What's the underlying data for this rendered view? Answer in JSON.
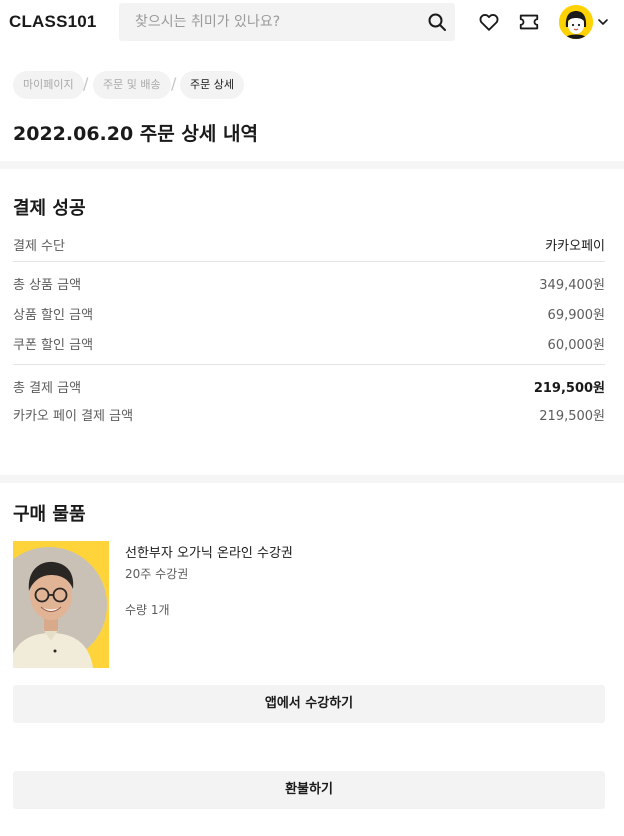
{
  "header": {
    "logo": "CLASS101",
    "search_placeholder": "찾으시는 취미가 있나요?",
    "icons": {
      "search": "search-icon",
      "wishlist": "heart-icon",
      "ticket": "ticket-icon",
      "avatar": "avatar",
      "menu": "chevron-down-icon"
    },
    "accent_color": "#ffd200"
  },
  "breadcrumb": {
    "items": [
      {
        "label": "마이페이지",
        "active": false
      },
      {
        "label": "주문 및 배송",
        "active": false
      },
      {
        "label": "주문 상세",
        "active": true
      }
    ]
  },
  "page_title": "2022.06.20 주문 상세 내역",
  "payment": {
    "title": "결제 성공",
    "method_label": "결제 수단",
    "method_value": "카카오페이",
    "rows": [
      {
        "label": "총 상품 금액",
        "value": "349,400원"
      },
      {
        "label": "상품 할인 금액",
        "value": "69,900원"
      },
      {
        "label": "쿠폰 할인 금액",
        "value": "60,000원"
      }
    ],
    "total_label": "총 결제 금액",
    "total_value": "219,500원",
    "kakao_label": "카카오 페이 결제 금액",
    "kakao_value": "219,500원"
  },
  "purchase": {
    "title": "구매 물품",
    "product": {
      "name": "선한부자 오가닉 온라인 수강권",
      "subtitle": "20주 수강권",
      "quantity": "수량 1개"
    },
    "watch_button": "앱에서 수강하기",
    "refund_button": "환불하기"
  }
}
